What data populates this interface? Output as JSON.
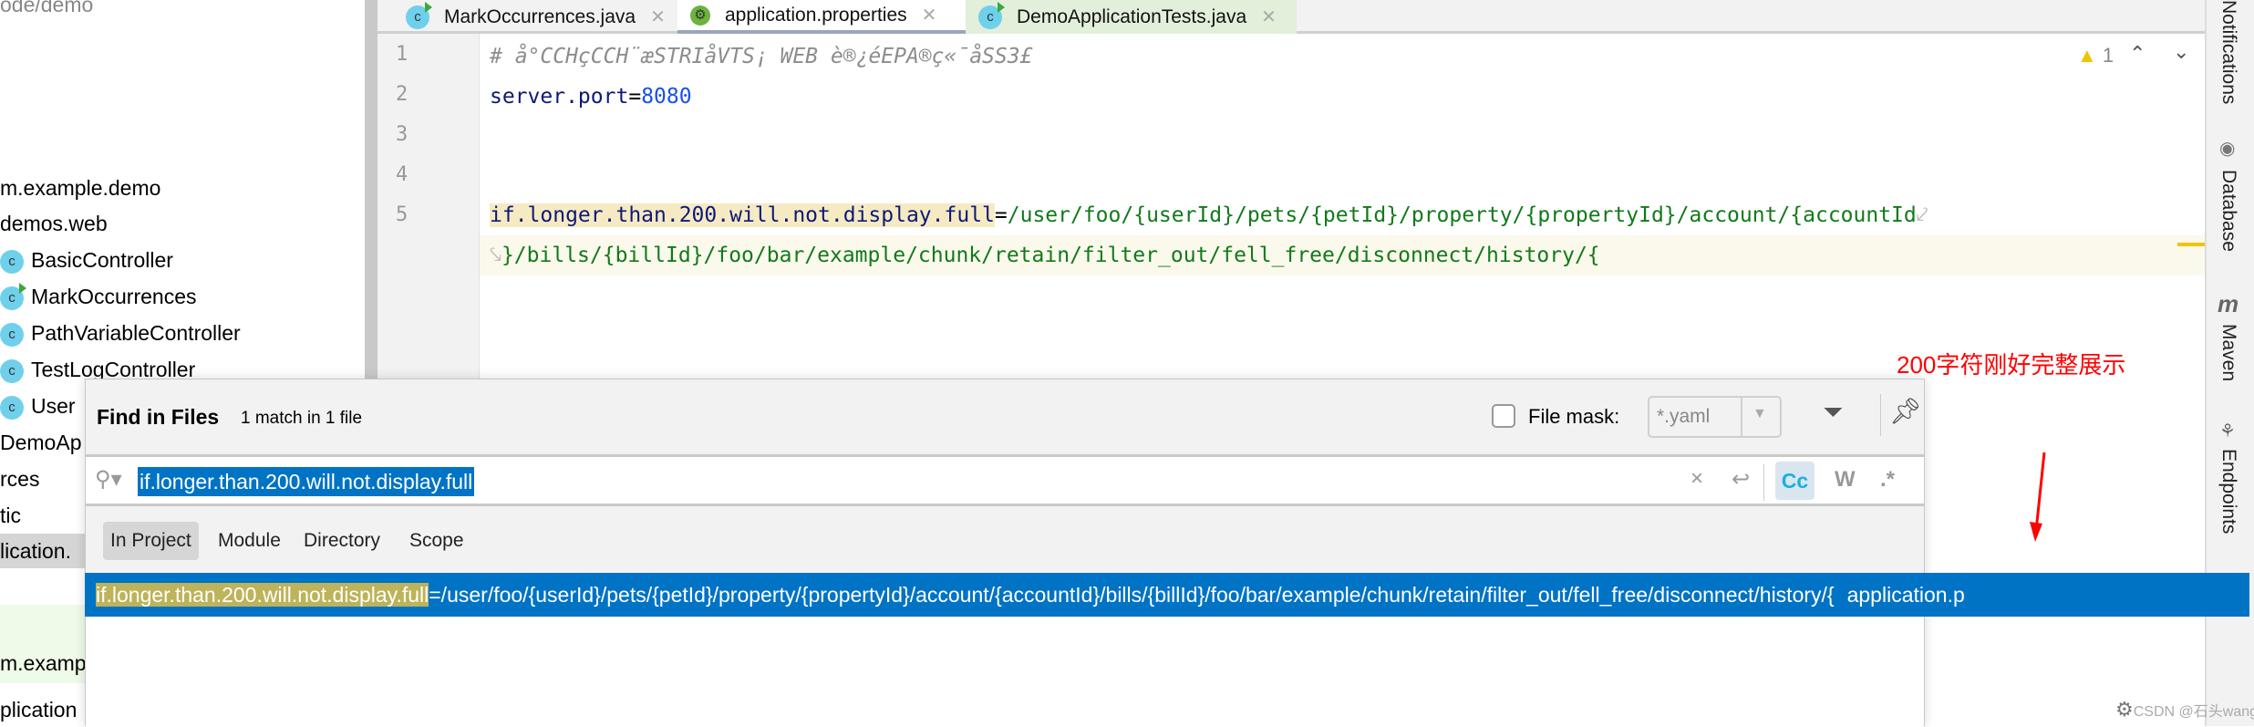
{
  "project_tree": {
    "path_fragment": "ode/demo",
    "items": [
      {
        "label": "m.example.demo",
        "icon": "none"
      },
      {
        "label": "demos.web",
        "icon": "none"
      },
      {
        "label": "BasicController",
        "icon": "class-icon"
      },
      {
        "label": "MarkOccurrences",
        "icon": "class-run-icon"
      },
      {
        "label": "PathVariableController",
        "icon": "class-icon"
      },
      {
        "label": "TestLogController",
        "icon": "class-icon"
      },
      {
        "label": "User",
        "icon": "class-icon"
      },
      {
        "label": "DemoAp",
        "icon": "none"
      },
      {
        "label": "rces",
        "icon": "none"
      },
      {
        "label": "tic",
        "icon": "none"
      },
      {
        "label": "lication.",
        "icon": "none",
        "selected": true
      },
      {
        "label": "m.examp",
        "icon": "none"
      },
      {
        "label": "plication",
        "icon": "none"
      }
    ]
  },
  "editor": {
    "tabs": [
      {
        "label": "MarkOccurrences.java",
        "icon": "class-icon"
      },
      {
        "label": "application.properties",
        "icon": "spring-properties-icon",
        "active": true
      },
      {
        "label": "DemoApplicationTests.java",
        "icon": "class-icon"
      }
    ],
    "line_numbers": [
      "1",
      "2",
      "3",
      "4",
      "5"
    ],
    "lines": {
      "l1": "# å°CCHçCCH¨æSTRIåVTS¡ WEB è®¿éEPA®ç«¯åSS3£",
      "l2_key": "server.port",
      "l2_eq": "=",
      "l2_val": "8080",
      "l5_key": "if.longer.than.200.will.not.display.full",
      "l5_eq": "=",
      "l5_val": "/user/foo/{userId}/pets/{petId}/property/{propertyId}/account/{accountId",
      "l5_wrap": "}/bills/{billId}/foo/bar/example/chunk/retain/filter_out/fell_free/disconnect/history/{"
    },
    "warning_count": "1"
  },
  "right_strip": [
    "Notifications",
    "Database",
    "Maven",
    "Endpoints"
  ],
  "annotation": {
    "text": "200字符刚好完整展示",
    "color": "#ff0000"
  },
  "find_dialog": {
    "title": "Find in Files",
    "match_summary": "1 match in 1 file",
    "file_mask_label": "File mask:",
    "file_mask_checked": false,
    "file_mask_value": "*.yaml",
    "search_value": "if.longer.than.200.will.not.display.full",
    "options": {
      "match_case": "Cc",
      "words": "W",
      "regex": ".*"
    },
    "scopes": [
      "In Project",
      "Module",
      "Directory",
      "Scope"
    ],
    "active_scope": "In Project",
    "result": {
      "match": "if.longer.than.200.will.not.display.full",
      "rest": "=/user/foo/{userId}/pets/{petId}/property/{propertyId}/account/{accountId}/bills/{billId}/foo/bar/example/chunk/retain/filter_out/fell_free/disconnect/history/{",
      "file": "application.p"
    }
  },
  "watermark": "CSDN @石头wang",
  "colors": {
    "selection": "#0073c5",
    "match_highlight": "#bdb35a",
    "accent_match_case": "#1ab0e0"
  }
}
